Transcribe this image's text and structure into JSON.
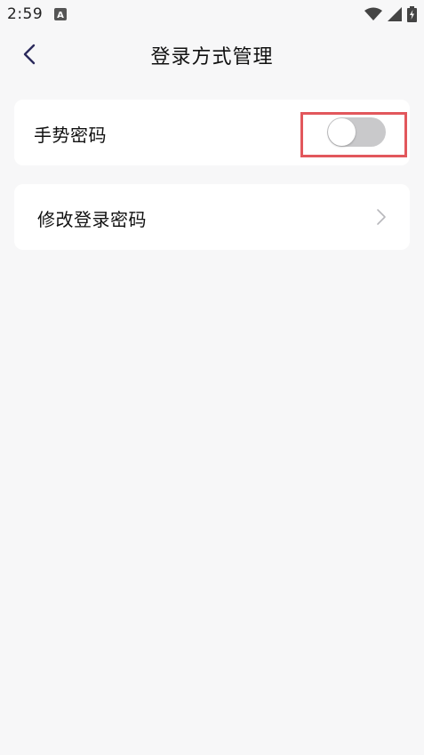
{
  "status_bar": {
    "time": "2:59",
    "icons": [
      "a-notification-icon",
      "wifi-icon",
      "signal-icon",
      "battery-charging-icon"
    ]
  },
  "header": {
    "title": "登录方式管理",
    "back_icon": "chevron-left-icon"
  },
  "settings": {
    "gesture_password": {
      "label": "手势密码",
      "enabled": false
    },
    "change_login_password": {
      "label": "修改登录密码",
      "icon": "chevron-right-icon"
    }
  },
  "colors": {
    "background": "#f7f7f8",
    "card": "#ffffff",
    "toggle_off": "#c9c9cb",
    "highlight": "#e2575c",
    "back_icon": "#2b2a5c"
  }
}
